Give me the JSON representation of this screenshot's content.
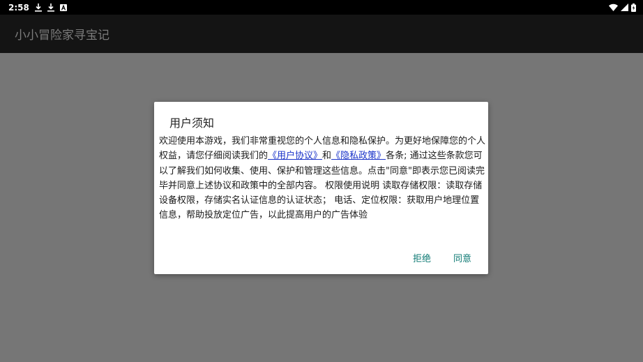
{
  "status_bar": {
    "time": "2:58",
    "left_icons": [
      "download-icon",
      "download-icon",
      "a-notification-icon"
    ],
    "right_icons": [
      "wifi-icon",
      "signal-icon",
      "battery-icon"
    ]
  },
  "app_bar": {
    "title": "小小冒险家寻宝记"
  },
  "dialog": {
    "title": "用户须知",
    "body": {
      "before_link1": "欢迎使用本游戏，我们非常重视您的个人信息和隐私保护。为更好地保障您的个人权益，请您仔细阅读我们的",
      "link1": "《用户协议》",
      "between_links": "和",
      "link2": "《隐私政策》",
      "after_link2": "各条; 通过这些条款您可以了解我们如何收集、使用、保护和管理这些信息。点击\"同意\"即表示您已阅读完毕并同意上述协议和政策中的全部内容。 权限使用说明 读取存储权限：读取存储设备权限，存储实名认证信息的认证状态； 电话、定位权限：获取用户地理位置信息，帮助投放定位广告，以此提高用户的广告体验"
    },
    "buttons": {
      "reject": "拒绝",
      "agree": "同意"
    }
  },
  "colors": {
    "scrim": "#757575",
    "app_bar_bg": "#141414",
    "link": "#1a33c9",
    "button_text": "#0f7a74"
  }
}
